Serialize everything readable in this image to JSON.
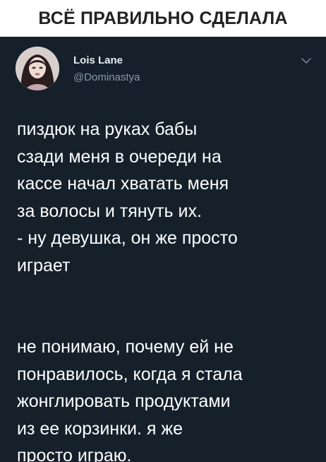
{
  "caption": {
    "text": "ВСЁ ПРАВИЛЬНО СДЕЛАЛА"
  },
  "tweet": {
    "author_name": "Lois Lane",
    "author_handle": "@Dominastya",
    "menu_icon": "chevron-down-icon",
    "avatar_icon": "user-avatar",
    "text_lines": [
      "пиздюк на руках бабы",
      "сзади меня в очереди на",
      "кассе начал хватать меня",
      "за волосы и тянуть их.",
      "- ну девушка, он же просто",
      "играет"
    ],
    "text_lines_2": [
      "не понимаю, почему ей не",
      "понравилось, когда я стала",
      "жонглировать продуктами",
      "из ее корзинки. я же",
      "просто играю."
    ]
  },
  "colors": {
    "card_background": "#15202b",
    "tweet_text": "#ffffff",
    "handle_text": "#8899a6",
    "caption_text": "#222222"
  }
}
